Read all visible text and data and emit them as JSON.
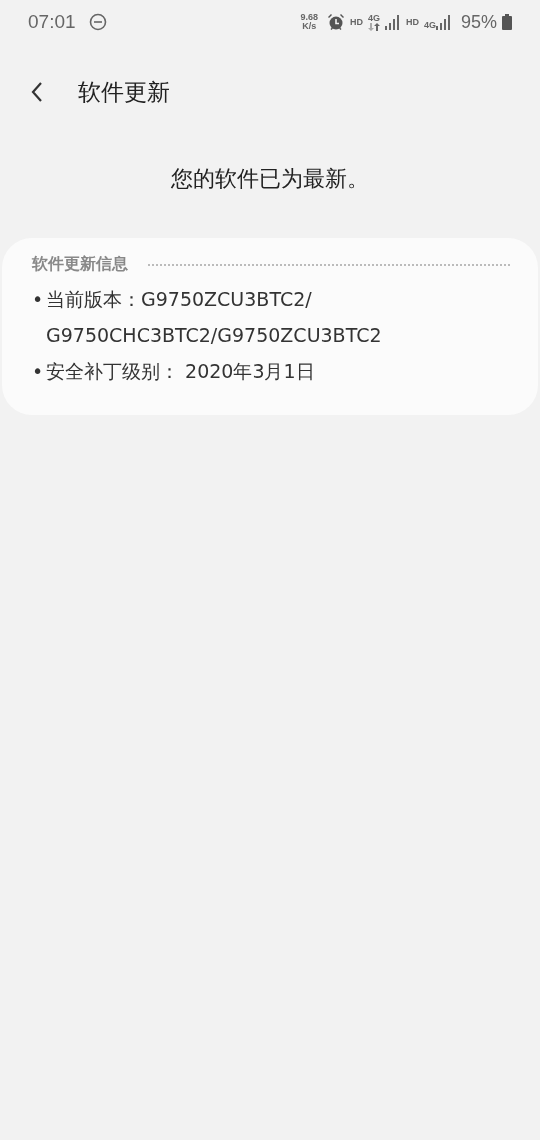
{
  "status_bar": {
    "time": "07:01",
    "speed_value": "9.68",
    "speed_unit": "K/s",
    "hd_1": "HD",
    "network_1": "4G",
    "hd_2": "HD",
    "network_2": "4G",
    "battery": "95%"
  },
  "header": {
    "title": "软件更新"
  },
  "message": "您的软件已为最新。",
  "card": {
    "title": "软件更新信息",
    "items": [
      {
        "bullet": "•",
        "lines": [
          "当前版本：G9750ZCU3BTC2/",
          "G9750CHC3BTC2/G9750ZCU3BTC2"
        ]
      },
      {
        "bullet": "•",
        "lines": [
          "安全补丁级别： 2020年3月1日"
        ]
      }
    ]
  }
}
